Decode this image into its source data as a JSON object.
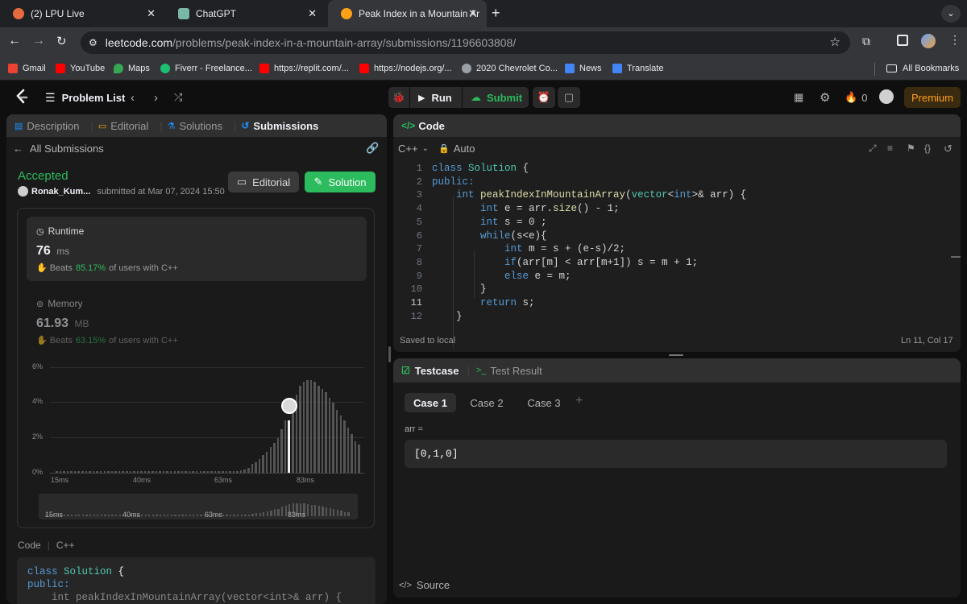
{
  "browser": {
    "tabs": [
      {
        "title": "(2) LPU Live",
        "favicon_color": "#e66a3f"
      },
      {
        "title": "ChatGPT",
        "favicon_color": "#7ab7a8"
      },
      {
        "title": "Peak Index in a Mountain Arra",
        "favicon_color": "#ffa116"
      }
    ],
    "url_host": "leetcode.com",
    "url_path": "/problems/peak-index-in-a-mountain-array/submissions/1196603808/",
    "bookmarks": [
      {
        "label": "Gmail",
        "color": "#ea4335"
      },
      {
        "label": "YouTube",
        "color": "#ff0000"
      },
      {
        "label": "Maps",
        "color": "#34a853"
      },
      {
        "label": "Fiverr - Freelance...",
        "color": "#1dbf73"
      },
      {
        "label": "https://replit.com/...",
        "color": "#ff0000"
      },
      {
        "label": "https://nodejs.org/...",
        "color": "#ff0000"
      },
      {
        "label": "2020 Chevrolet Co...",
        "color": "#9aa0a6"
      },
      {
        "label": "News",
        "color": "#4285f4"
      },
      {
        "label": "Translate",
        "color": "#4285f4"
      }
    ],
    "all_bookmarks": "All Bookmarks"
  },
  "nav": {
    "problem_list": "Problem List",
    "run": "Run",
    "submit": "Submit",
    "streak": "0",
    "premium": "Premium"
  },
  "left": {
    "tabs": [
      "Description",
      "Editorial",
      "Solutions",
      "Submissions"
    ],
    "all_submissions": "All Submissions",
    "status": "Accepted",
    "user": "Ronak_Kum...",
    "submitted": "submitted at Mar 07, 2024 15:50",
    "editorial_btn": "Editorial",
    "solution_btn": "Solution",
    "runtime": {
      "label": "Runtime",
      "value": "76",
      "unit": "ms",
      "beats": "Beats",
      "percent": "85.17%",
      "suffix": "of users with C++"
    },
    "memory": {
      "label": "Memory",
      "value": "61.93",
      "unit": "MB",
      "beats": "Beats",
      "percent": "63.15%",
      "suffix": "of users with C++"
    },
    "code_label": "Code",
    "lang_label": "C++",
    "code_preview": [
      "class Solution {",
      "public:",
      "    int peakIndexInMountainArray(vector<int>& arr) {"
    ]
  },
  "chart_data": {
    "type": "bar",
    "ylabel": "",
    "yticks": [
      "6%",
      "4%",
      "2%",
      "0%"
    ],
    "ylim": [
      0,
      6
    ],
    "xticks": [
      "15ms",
      "40ms",
      "63ms",
      "83ms"
    ],
    "mini_xticks": [
      "15ms",
      "40ms",
      "63ms",
      "83ms"
    ],
    "highlight_index": 63,
    "values": [
      0.1,
      0.1,
      0.1,
      0.1,
      0.1,
      0.1,
      0.1,
      0.1,
      0.1,
      0.1,
      0.1,
      0.1,
      0.1,
      0.1,
      0.1,
      0.1,
      0.1,
      0.1,
      0.1,
      0.1,
      0.1,
      0.1,
      0.1,
      0.1,
      0.1,
      0.1,
      0.1,
      0.1,
      0.1,
      0.1,
      0.1,
      0.1,
      0.1,
      0.1,
      0.1,
      0.1,
      0.1,
      0.1,
      0.1,
      0.1,
      0.1,
      0.1,
      0.1,
      0.1,
      0.1,
      0.1,
      0.1,
      0.1,
      0.1,
      0.1,
      0.15,
      0.2,
      0.3,
      0.5,
      0.6,
      0.8,
      1.0,
      1.2,
      1.5,
      1.7,
      2.0,
      2.5,
      3.0,
      3.0,
      4.0,
      4.5,
      5.0,
      5.2,
      5.3,
      5.3,
      5.2,
      5.0,
      4.8,
      4.6,
      4.3,
      4.0,
      3.6,
      3.3,
      3.0,
      2.6,
      2.2,
      1.8,
      1.6
    ]
  },
  "editor": {
    "title": "Code",
    "lang": "C++",
    "mode": "Auto",
    "lines": [
      [
        {
          "t": "class ",
          "c": "kw"
        },
        {
          "t": "Solution",
          "c": "ty"
        },
        {
          "t": " {",
          "c": "cm"
        }
      ],
      [
        {
          "t": "public:",
          "c": "kw"
        }
      ],
      [
        {
          "t": "    ",
          "c": "cm"
        },
        {
          "t": "int ",
          "c": "kw"
        },
        {
          "t": "peakIndexInMountainArray",
          "c": "fn"
        },
        {
          "t": "(",
          "c": "cm"
        },
        {
          "t": "vector",
          "c": "ty"
        },
        {
          "t": "<",
          "c": "cm"
        },
        {
          "t": "int",
          "c": "kw"
        },
        {
          "t": ">& arr) {",
          "c": "cm"
        }
      ],
      [
        {
          "t": "        ",
          "c": "cm"
        },
        {
          "t": "int ",
          "c": "kw"
        },
        {
          "t": "e = arr.",
          "c": "cm"
        },
        {
          "t": "size",
          "c": "fn"
        },
        {
          "t": "() - 1;",
          "c": "cm"
        }
      ],
      [
        {
          "t": "        ",
          "c": "cm"
        },
        {
          "t": "int ",
          "c": "kw"
        },
        {
          "t": "s = 0 ;",
          "c": "cm"
        }
      ],
      [
        {
          "t": "        ",
          "c": "cm"
        },
        {
          "t": "while",
          "c": "kw"
        },
        {
          "t": "(s<e){",
          "c": "cm"
        }
      ],
      [
        {
          "t": "            ",
          "c": "cm"
        },
        {
          "t": "int ",
          "c": "kw"
        },
        {
          "t": "m = s + (e-s)/2;",
          "c": "cm"
        }
      ],
      [
        {
          "t": "            ",
          "c": "cm"
        },
        {
          "t": "if",
          "c": "kw"
        },
        {
          "t": "(arr[m] < arr[m+1]) s = m + 1;",
          "c": "cm"
        }
      ],
      [
        {
          "t": "            ",
          "c": "cm"
        },
        {
          "t": "else ",
          "c": "kw"
        },
        {
          "t": "e = m;",
          "c": "cm"
        }
      ],
      [
        {
          "t": "        }",
          "c": "cm"
        }
      ],
      [
        {
          "t": "        ",
          "c": "cm"
        },
        {
          "t": "return ",
          "c": "kw"
        },
        {
          "t": "s;",
          "c": "cm"
        }
      ],
      [
        {
          "t": "    }",
          "c": "cm"
        }
      ]
    ],
    "saved": "Saved to local",
    "cursor": "Ln 11, Col 17"
  },
  "testcase": {
    "tab": "Testcase",
    "result_tab": "Test Result",
    "cases": [
      "Case 1",
      "Case 2",
      "Case 3"
    ],
    "param": "arr =",
    "value": "[0,1,0]",
    "source": "Source"
  }
}
